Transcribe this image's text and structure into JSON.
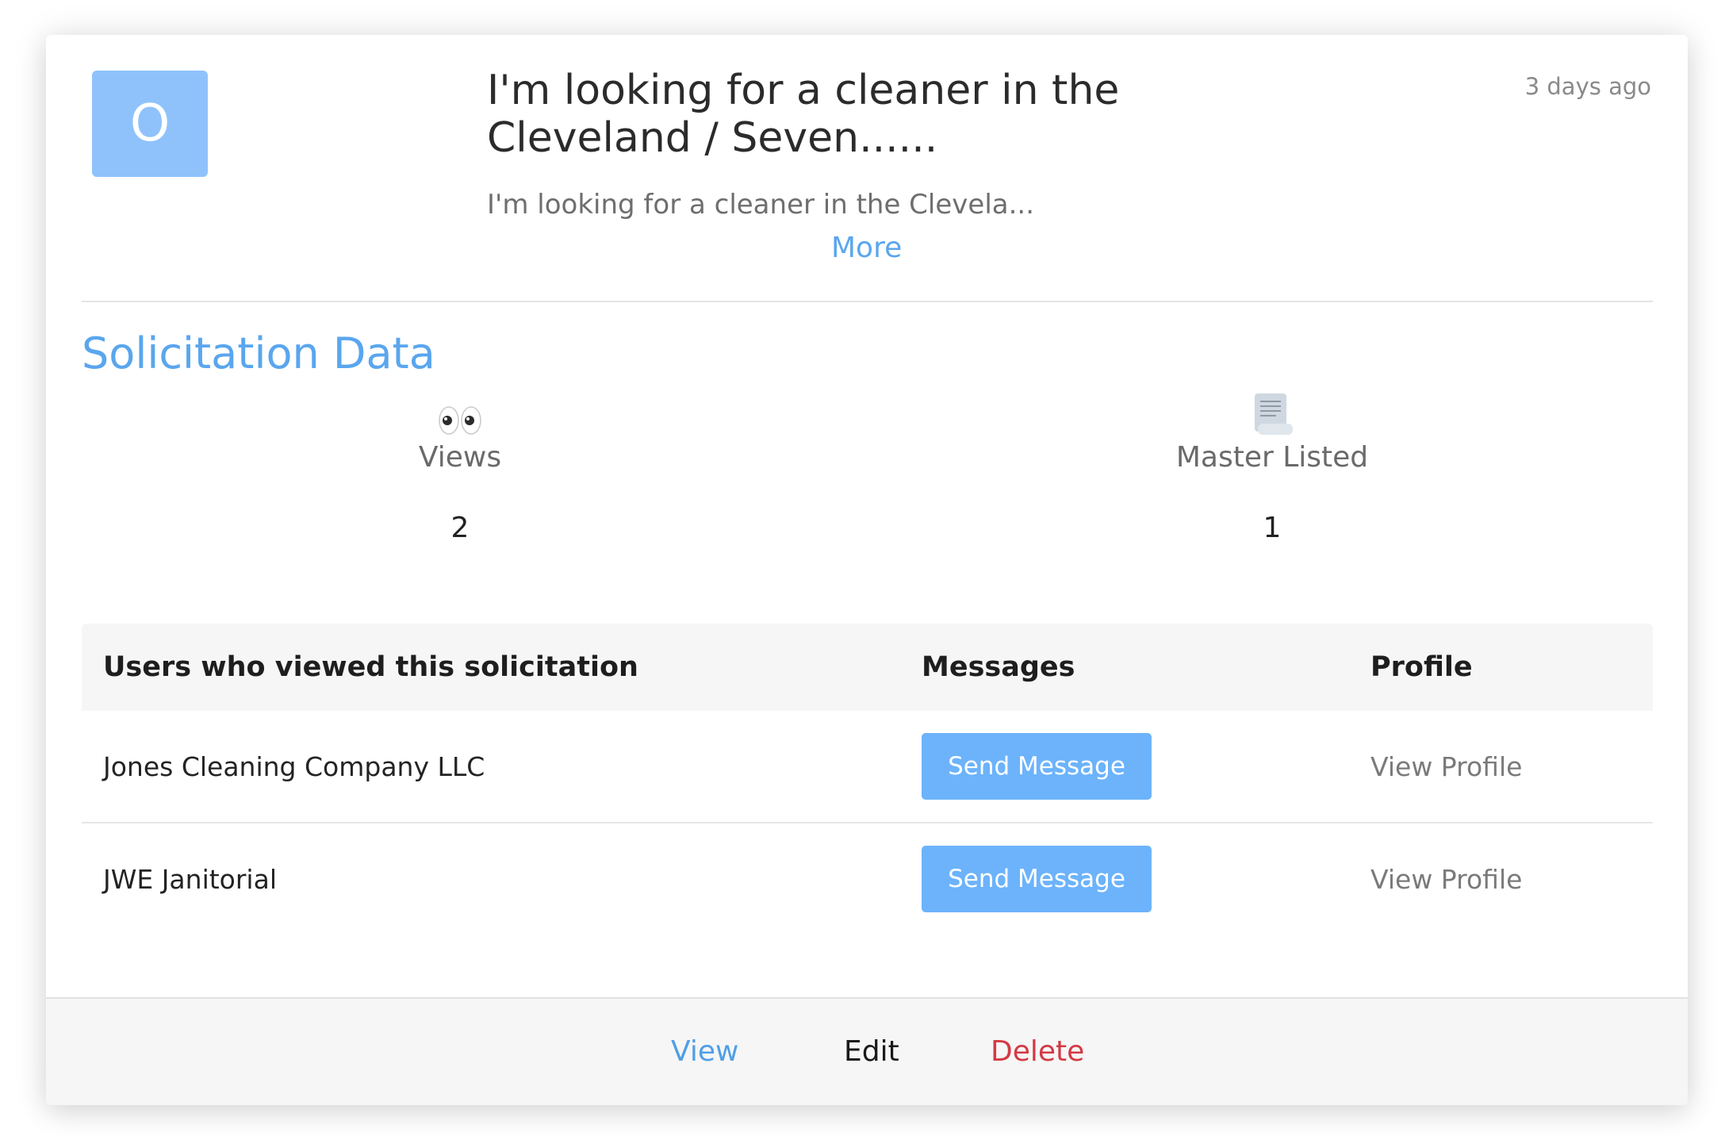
{
  "solicitation": {
    "avatar_letter": "O",
    "title": "I'm looking for a cleaner in the Cleveland / Seven......",
    "excerpt": "I'm looking for a cleaner in the Clevela...",
    "more_label": "More",
    "timestamp": "3 days ago"
  },
  "data_section": {
    "title": "Solicitation Data",
    "stats": [
      {
        "label": "Views",
        "value": "2",
        "icon": "eyes-icon"
      },
      {
        "label": "Master Listed",
        "value": "1",
        "icon": "scroll-icon"
      }
    ]
  },
  "viewers_table": {
    "headers": {
      "user": "Users who viewed this solicitation",
      "messages": "Messages",
      "profile": "Profile"
    },
    "rows": [
      {
        "name": "Jones Cleaning Company LLC",
        "message_label": "Send Message",
        "profile_label": "View Profile"
      },
      {
        "name": "JWE Janitorial",
        "message_label": "Send Message",
        "profile_label": "View Profile"
      }
    ]
  },
  "footer": {
    "view_label": "View",
    "edit_label": "Edit",
    "delete_label": "Delete"
  },
  "colors": {
    "accent": "#5aa6ee",
    "button": "#6cb3fb",
    "avatar": "#8fc2fb",
    "danger": "#d33a44"
  }
}
